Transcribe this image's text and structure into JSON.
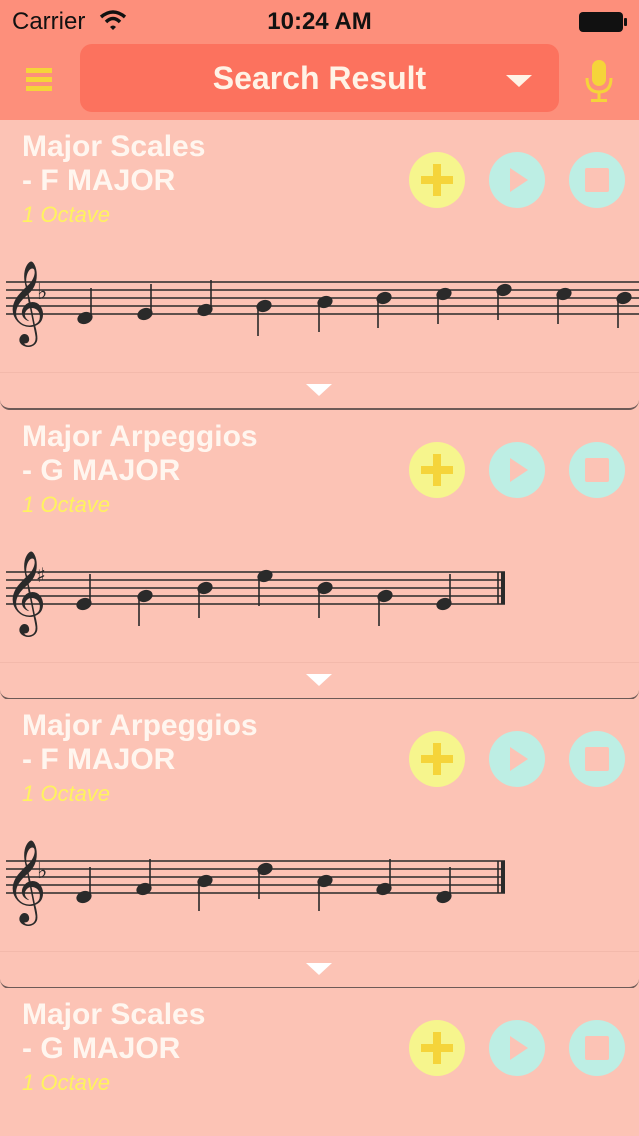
{
  "status_bar": {
    "carrier": "Carrier",
    "time": "10:24 AM"
  },
  "header": {
    "title": "Search Result",
    "menu_icon": "hamburger-menu-icon",
    "dropdown_icon": "chevron-down-icon",
    "mic_icon": "microphone-icon"
  },
  "colors": {
    "header_bg": "#fd8f7b",
    "title_pill_bg": "#fc725e",
    "card_bg": "#fcc3b5",
    "accent_yellow": "#f5d43a",
    "add_button_bg": "#f6f58d",
    "play_button_bg": "#bdeee4",
    "subtitle_yellow": "#fff35f"
  },
  "results": [
    {
      "category": "Major Scales",
      "key": "- F MAJOR",
      "octave": "1 Octave"
    },
    {
      "category": "Major Arpeggios",
      "key": "- G MAJOR",
      "octave": "1 Octave"
    },
    {
      "category": "Major Arpeggios",
      "key": "- F MAJOR",
      "octave": "1 Octave"
    },
    {
      "category": "Major Scales",
      "key": "- G MAJOR",
      "octave": "1 Octave"
    }
  ]
}
